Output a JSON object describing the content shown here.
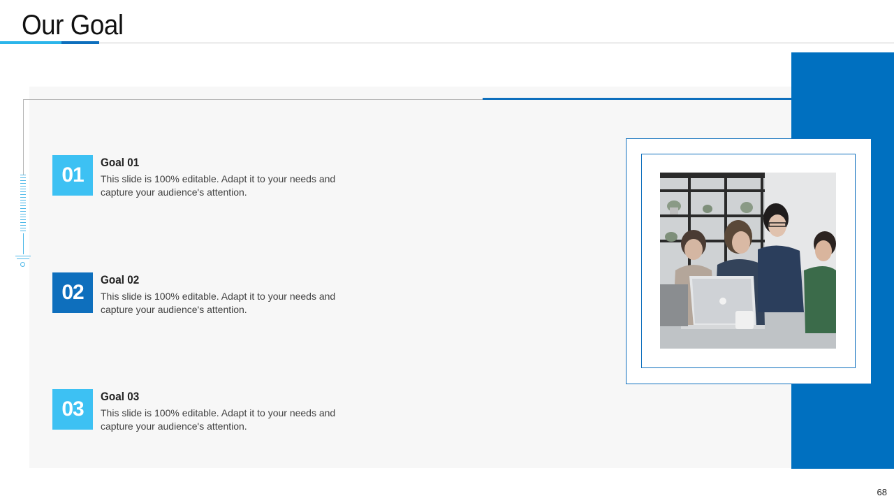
{
  "slide": {
    "title": "Our Goal",
    "page_number": "68"
  },
  "goals": [
    {
      "number": "01",
      "title": "Goal 01",
      "description": "This slide is 100% editable. Adapt it to your needs and capture your audience's attention.",
      "color": "#3dc1f3"
    },
    {
      "number": "02",
      "title": "Goal 02",
      "description": "This slide is 100% editable. Adapt it to your needs and capture your audience's attention.",
      "color": "#0e6fbd"
    },
    {
      "number": "03",
      "title": "Goal 03",
      "description": "This slide is 100% editable. Adapt it to your needs and capture your audience's attention.",
      "color": "#3dc1f3"
    }
  ],
  "theme": {
    "accent_dark": "#0070c0",
    "accent_light": "#3dc1f3",
    "panel_bg": "#f7f7f7"
  }
}
